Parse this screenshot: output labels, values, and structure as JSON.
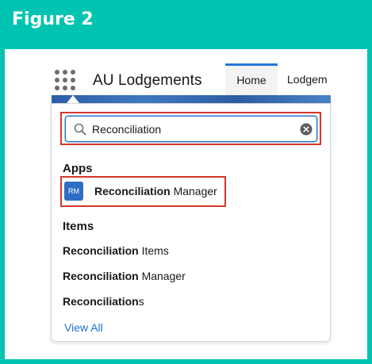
{
  "figure": {
    "title": "Figure 2"
  },
  "nav": {
    "app_name": "AU Lodgements",
    "tabs": [
      {
        "label": "Home",
        "active": true
      },
      {
        "label": "Lodgem"
      }
    ]
  },
  "search": {
    "value": "Reconciliation"
  },
  "sections": {
    "apps": "Apps",
    "items": "Items"
  },
  "apps": [
    {
      "badge": "RM",
      "match": "Reconciliation",
      "rest": " Manager"
    }
  ],
  "items": [
    {
      "match": "Reconciliation",
      "rest": " Items"
    },
    {
      "match": "Reconciliation",
      "rest": " Manager"
    },
    {
      "match": "Reconciliation",
      "rest": "s"
    }
  ],
  "view_all": "View All",
  "colors": {
    "frame": "#00c4b1",
    "highlight": "#d6362c",
    "accent": "#1b73d3",
    "badge": "#2f6dc4"
  }
}
